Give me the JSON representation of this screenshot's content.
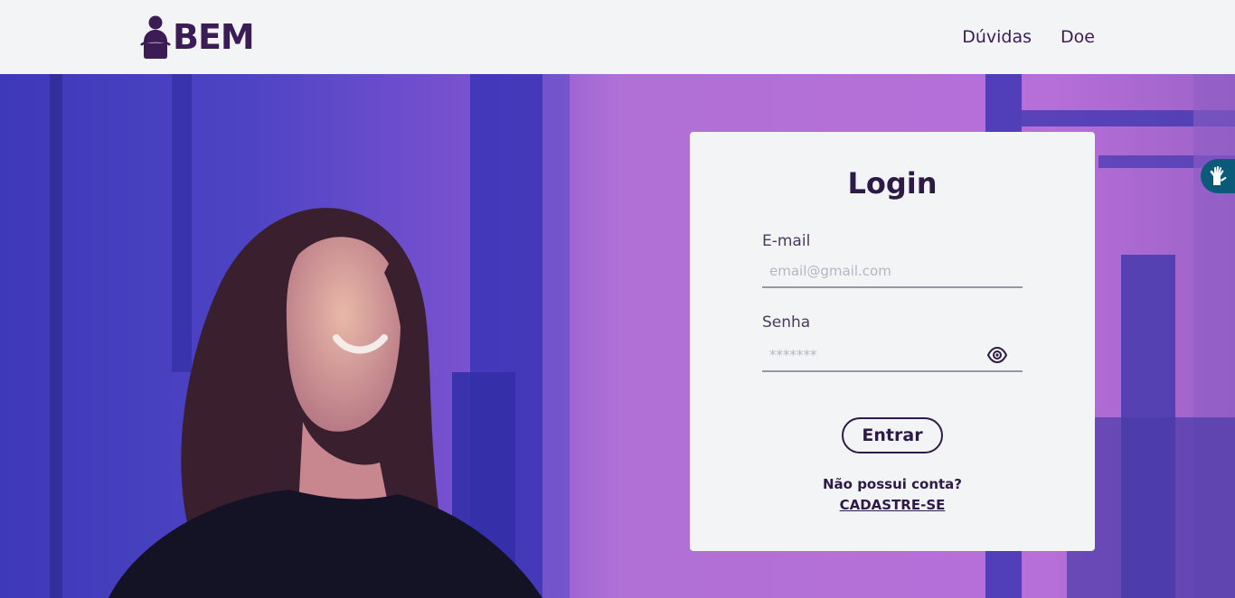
{
  "brand": {
    "name": "BEM"
  },
  "nav": {
    "items": [
      {
        "label": "Dúvidas"
      },
      {
        "label": "Doe"
      }
    ]
  },
  "login": {
    "title": "Login",
    "email": {
      "label": "E-mail",
      "placeholder": "email@gmail.com",
      "value": ""
    },
    "password": {
      "label": "Senha",
      "placeholder": "*******",
      "value": ""
    },
    "submit_label": "Entrar",
    "no_account_text": "Não possui conta?",
    "signup_label": "CADASTRE-SE"
  },
  "icons": {
    "password_toggle": "eye-icon",
    "accessibility": "sign-language-icon"
  },
  "colors": {
    "brand": "#3b1c55",
    "navbar_bg": "#f3f4f6",
    "card_bg": "#f3f4f6",
    "hero_accent": "#b66fd6",
    "a11y_tab": "#0b5a7a"
  }
}
